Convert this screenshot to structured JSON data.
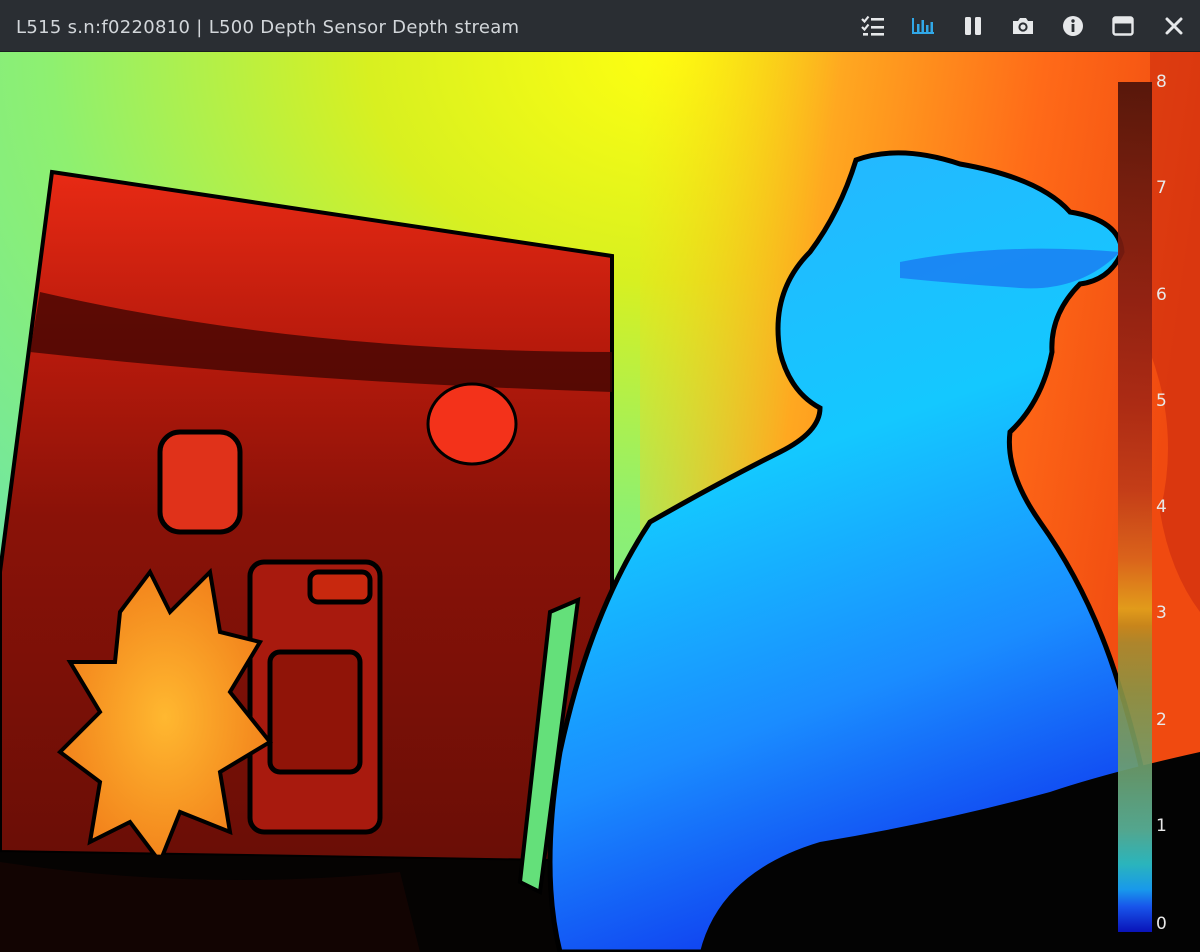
{
  "window": {
    "title": "L515 s.n:f0220810 | L500 Depth Sensor Depth stream"
  },
  "toolbar": {
    "buttons": [
      {
        "name": "options-list-icon"
      },
      {
        "name": "metadata-chart-icon",
        "active": true
      },
      {
        "name": "pause-icon"
      },
      {
        "name": "camera-snapshot-icon"
      },
      {
        "name": "info-icon"
      },
      {
        "name": "maximize-icon"
      },
      {
        "name": "close-icon"
      }
    ],
    "colors": {
      "icon": "#e6e8ea",
      "active_icon": "#31a8e8",
      "titlebar_bg": "#2a2e33",
      "title_text": "#d2d6da"
    }
  },
  "colormap": {
    "ticks": [
      "8",
      "7",
      "6",
      "5",
      "4",
      "3",
      "2",
      "1",
      "0"
    ],
    "range": [
      0,
      8
    ]
  }
}
